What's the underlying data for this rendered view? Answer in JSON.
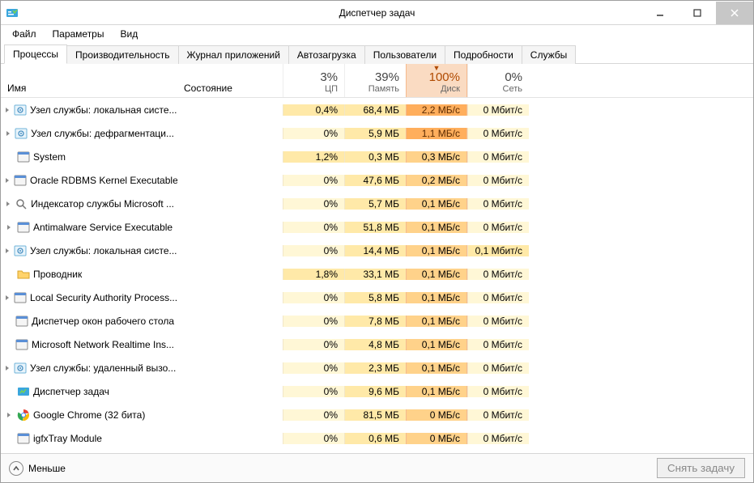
{
  "window": {
    "title": "Диспетчер задач"
  },
  "menu": {
    "file": "Файл",
    "options": "Параметры",
    "view": "Вид"
  },
  "tabs": {
    "processes": "Процессы",
    "performance": "Производительность",
    "app_history": "Журнал приложений",
    "startup": "Автозагрузка",
    "users": "Пользователи",
    "details": "Подробности",
    "services": "Службы"
  },
  "columns": {
    "name": "Имя",
    "status": "Состояние",
    "cpu_pct": "3%",
    "cpu_lbl": "ЦП",
    "mem_pct": "39%",
    "mem_lbl": "Память",
    "disk_pct": "100%",
    "disk_lbl": "Диск",
    "net_pct": "0%",
    "net_lbl": "Сеть"
  },
  "rows": [
    {
      "expandable": true,
      "icon": "gear",
      "name": "Узел службы: локальная систе...",
      "cpu": "0,4%",
      "cpu_hot": true,
      "mem": "68,4 МБ",
      "disk": "2,2 МБ/с",
      "disk_hot": true,
      "net": "0 Мбит/с"
    },
    {
      "expandable": true,
      "icon": "gear",
      "name": "Узел службы: дефрагментаци...",
      "cpu": "0%",
      "mem": "5,9 МБ",
      "disk": "1,1 МБ/с",
      "disk_hot": true,
      "net": "0 Мбит/с"
    },
    {
      "expandable": false,
      "icon": "app",
      "name": "System",
      "cpu": "1,2%",
      "cpu_hot": true,
      "mem": "0,3 МБ",
      "disk": "0,3 МБ/с",
      "net": "0 Мбит/с"
    },
    {
      "expandable": true,
      "icon": "app",
      "name": "Oracle RDBMS Kernel Executable",
      "cpu": "0%",
      "mem": "47,6 МБ",
      "disk": "0,2 МБ/с",
      "net": "0 Мбит/с"
    },
    {
      "expandable": true,
      "icon": "search",
      "name": "Индексатор службы Microsoft ...",
      "cpu": "0%",
      "mem": "5,7 МБ",
      "disk": "0,1 МБ/с",
      "net": "0 Мбит/с"
    },
    {
      "expandable": true,
      "icon": "app",
      "name": "Antimalware Service Executable",
      "cpu": "0%",
      "mem": "51,8 МБ",
      "disk": "0,1 МБ/с",
      "net": "0 Мбит/с"
    },
    {
      "expandable": true,
      "icon": "gear",
      "name": "Узел службы: локальная систе...",
      "cpu": "0%",
      "mem": "14,4 МБ",
      "disk": "0,1 МБ/с",
      "net": "0,1 Мбит/с",
      "net_hot": true
    },
    {
      "expandable": false,
      "icon": "folder",
      "name": "Проводник",
      "cpu": "1,8%",
      "cpu_hot": true,
      "mem": "33,1 МБ",
      "disk": "0,1 МБ/с",
      "net": "0 Мбит/с"
    },
    {
      "expandable": true,
      "icon": "app",
      "name": "Local Security Authority Process...",
      "cpu": "0%",
      "mem": "5,8 МБ",
      "disk": "0,1 МБ/с",
      "net": "0 Мбит/с"
    },
    {
      "expandable": false,
      "icon": "app",
      "name": "Диспетчер окон рабочего стола",
      "cpu": "0%",
      "mem": "7,8 МБ",
      "disk": "0,1 МБ/с",
      "net": "0 Мбит/с"
    },
    {
      "expandable": false,
      "icon": "app",
      "name": "Microsoft Network Realtime Ins...",
      "cpu": "0%",
      "mem": "4,8 МБ",
      "disk": "0,1 МБ/с",
      "net": "0 Мбит/с"
    },
    {
      "expandable": true,
      "icon": "gear",
      "name": "Узел службы: удаленный вызо...",
      "cpu": "0%",
      "mem": "2,3 МБ",
      "disk": "0,1 МБ/с",
      "net": "0 Мбит/с"
    },
    {
      "expandable": false,
      "icon": "tm",
      "name": "Диспетчер задач",
      "cpu": "0%",
      "mem": "9,6 МБ",
      "disk": "0,1 МБ/с",
      "net": "0 Мбит/с"
    },
    {
      "expandable": true,
      "icon": "chrome",
      "name": "Google Chrome (32 бита)",
      "cpu": "0%",
      "mem": "81,5 МБ",
      "disk": "0 МБ/с",
      "net": "0 Мбит/с"
    },
    {
      "expandable": false,
      "icon": "app",
      "name": "igfxTray Module",
      "cpu": "0%",
      "mem": "0,6 МБ",
      "disk": "0 МБ/с",
      "net": "0 Мбит/с"
    }
  ],
  "footer": {
    "fewer": "Меньше",
    "end_task": "Снять задачу"
  }
}
